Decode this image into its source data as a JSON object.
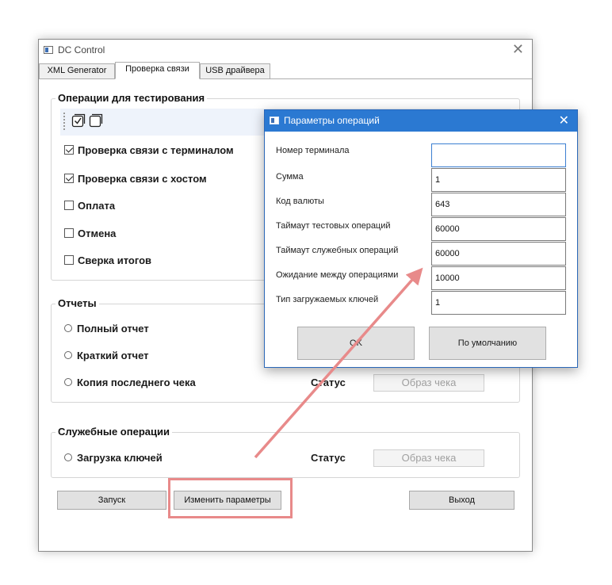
{
  "window": {
    "title": "DC Control"
  },
  "tabs": [
    {
      "label": "XML Generator"
    },
    {
      "label": "Проверка связи"
    },
    {
      "label": "USB драйвера"
    }
  ],
  "operations_group": {
    "title": "Операции для тестирования",
    "items": [
      {
        "label": "Проверка связи с терминалом",
        "checked": true
      },
      {
        "label": "Проверка связи с хостом",
        "checked": true
      },
      {
        "label": "Оплата",
        "checked": false
      },
      {
        "label": "Отмена",
        "checked": false
      },
      {
        "label": "Сверка итогов",
        "checked": false
      }
    ]
  },
  "reports_group": {
    "title": "Отчеты",
    "items": [
      {
        "label": "Полный отчет"
      },
      {
        "label": "Краткий отчет"
      },
      {
        "label": "Копия последнего чека"
      }
    ],
    "status_label": "Статус",
    "receipt_button": "Образ чека"
  },
  "service_group": {
    "title": "Служебные операции",
    "items": [
      {
        "label": "Загрузка ключей"
      }
    ],
    "status_label": "Статус",
    "receipt_button": "Образ чека"
  },
  "buttons": {
    "run": "Запуск",
    "change_params": "Изменить параметры",
    "exit": "Выход"
  },
  "dialog": {
    "title": "Параметры операций",
    "params": [
      {
        "label": "Номер терминала",
        "value": ""
      },
      {
        "label": "Сумма",
        "value": "1"
      },
      {
        "label": "Код валюты",
        "value": "643"
      },
      {
        "label": "Таймаут тестовых операций",
        "value": "60000"
      },
      {
        "label": "Таймаут служебных операций",
        "value": "60000"
      },
      {
        "label": "Ожидание между операциями",
        "value": "10000"
      },
      {
        "label": "Тип загружаемых ключей",
        "value": "1"
      }
    ],
    "ok_button": "OK",
    "default_button": "По умолчанию"
  },
  "colors": {
    "dialog_titlebar": "#2b79d2",
    "annotation": "#e88a8a"
  }
}
